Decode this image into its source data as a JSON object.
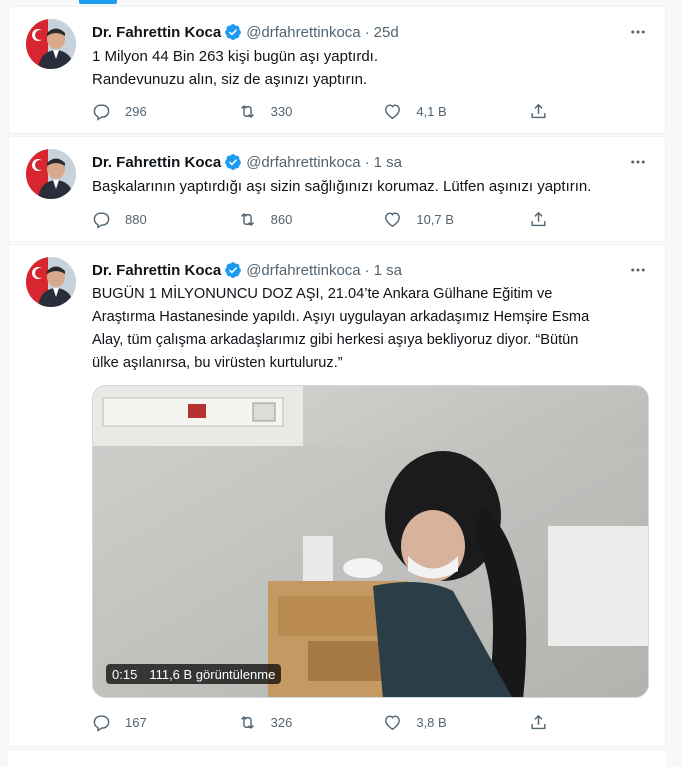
{
  "author": {
    "name": "Dr. Fahrettin Koca",
    "handle": "@drfahrettinkoca"
  },
  "tweets": [
    {
      "time": "25d",
      "lines": [
        "1 Milyon 44 Bin 263 kişi bugün aşı yaptırdı.",
        "Randevunuzu alın, siz de aşınızı yaptırın."
      ],
      "replies": "296",
      "retweets": "330",
      "likes": "4,1 B"
    },
    {
      "time": "1 sa",
      "lines": [
        "Başkalarının yaptırdığı aşı sizin sağlığınızı korumaz. Lütfen aşınızı yaptırın."
      ],
      "replies": "880",
      "retweets": "860",
      "likes": "10,7 B"
    },
    {
      "time": "1 sa",
      "lines": [
        "BUGÜN 1 MİLYONUNCU DOZ AŞI, 21.04’te Ankara Gülhane Eğitim ve",
        "Araştırma Hastanesinde yapıldı. Aşıyı uygulayan arkadaşımız Hemşire Esma",
        "Alay, tüm çalışma arkadaşlarımız gibi herkesi aşıya bekliyoruz diyor. “Bütün",
        "ülke aşılanırsa, bu virüsten kurtuluruz.”"
      ],
      "video": {
        "duration": "0:15",
        "views": "111,6 B görüntülenme"
      },
      "replies": "167",
      "retweets": "326",
      "likes": "3,8 B"
    }
  ],
  "colors": {
    "accent": "#1d9bf0",
    "muted_text": "#536471",
    "verified": "#1d9bf0"
  },
  "icons": {
    "reply": "reply-icon",
    "retweet": "retweet-icon",
    "like": "like-icon",
    "share": "share-icon",
    "more": "more-icon",
    "verified": "verified-badge-icon"
  }
}
